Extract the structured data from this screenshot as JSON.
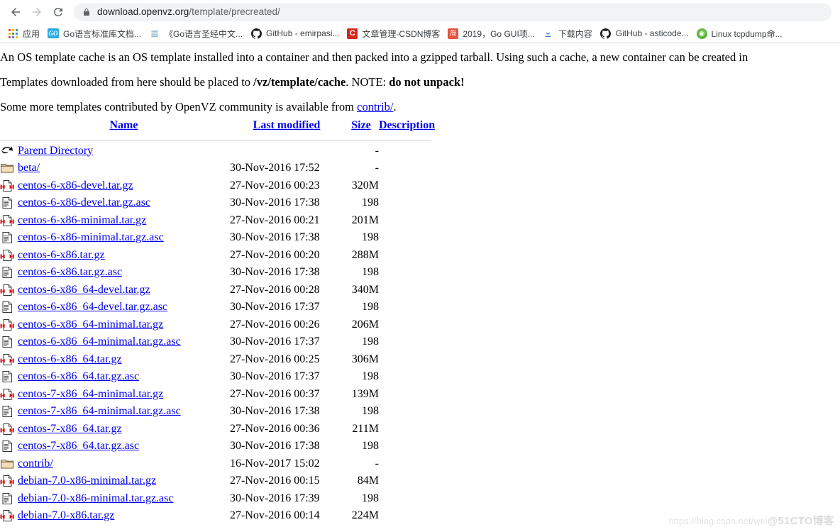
{
  "browser": {
    "back_icon": "back-arrow-icon",
    "forward_icon": "forward-arrow-icon",
    "reload_icon": "reload-icon",
    "lock_icon": "lock-icon",
    "url_host": "download.openvz.org",
    "url_path": "/template/precreated/",
    "url_full": "download.openvz.org/template/precreated/"
  },
  "bookmarks": [
    {
      "label": "应用",
      "icon": "apps-grid-icon"
    },
    {
      "label": "Go语言标准库文档...",
      "icon": "go-icon"
    },
    {
      "label": "《Go语言圣经中文...",
      "icon": "book-icon"
    },
    {
      "label": "GitHub - emirpasi...",
      "icon": "github-icon"
    },
    {
      "label": "文章管理-CSDN博客",
      "icon": "csdn-icon"
    },
    {
      "label": "2019，Go GUI项...",
      "icon": "jianshu-icon"
    },
    {
      "label": "下载内容",
      "icon": "download-icon"
    },
    {
      "label": "GitHub - asticode...",
      "icon": "github-icon"
    },
    {
      "label": "Linux tcpdump命...",
      "icon": "linux-icon"
    }
  ],
  "page": {
    "para1": "An OS template cache is an OS template installed into a container and then packed into a gzipped tarball. Using such a cache, a new container can be created in",
    "para2_pre": "Templates downloaded from here should be placed to ",
    "para2_path": "/vz/template/cache",
    "para2_mid": ". NOTE: ",
    "para2_bold": "do not unpack!",
    "para3_pre": "Some more templates contributed by OpenVZ community is available from ",
    "para3_link": "contrib/",
    "para3_post": "."
  },
  "table": {
    "headers": {
      "name": "Name",
      "last_modified": "Last modified",
      "size": "Size",
      "description": "Description"
    },
    "rows": [
      {
        "icon": "back-icon",
        "name": "Parent Directory",
        "modified": "",
        "size": "-",
        "desc": ""
      },
      {
        "icon": "folder-icon",
        "name": "beta/",
        "modified": "30-Nov-2016 17:52",
        "size": "-",
        "desc": ""
      },
      {
        "icon": "gz-icon",
        "name": "centos-6-x86-devel.tar.gz",
        "modified": "27-Nov-2016 00:23",
        "size": "320M",
        "desc": ""
      },
      {
        "icon": "text-icon",
        "name": "centos-6-x86-devel.tar.gz.asc",
        "modified": "30-Nov-2016 17:38",
        "size": "198",
        "desc": ""
      },
      {
        "icon": "gz-icon",
        "name": "centos-6-x86-minimal.tar.gz",
        "modified": "27-Nov-2016 00:21",
        "size": "201M",
        "desc": ""
      },
      {
        "icon": "text-icon",
        "name": "centos-6-x86-minimal.tar.gz.asc",
        "modified": "30-Nov-2016 17:38",
        "size": "198",
        "desc": ""
      },
      {
        "icon": "gz-icon",
        "name": "centos-6-x86.tar.gz",
        "modified": "27-Nov-2016 00:20",
        "size": "288M",
        "desc": ""
      },
      {
        "icon": "text-icon",
        "name": "centos-6-x86.tar.gz.asc",
        "modified": "30-Nov-2016 17:38",
        "size": "198",
        "desc": ""
      },
      {
        "icon": "gz-icon",
        "name": "centos-6-x86_64-devel.tar.gz",
        "modified": "27-Nov-2016 00:28",
        "size": "340M",
        "desc": ""
      },
      {
        "icon": "text-icon",
        "name": "centos-6-x86_64-devel.tar.gz.asc",
        "modified": "30-Nov-2016 17:37",
        "size": "198",
        "desc": ""
      },
      {
        "icon": "gz-icon",
        "name": "centos-6-x86_64-minimal.tar.gz",
        "modified": "27-Nov-2016 00:26",
        "size": "206M",
        "desc": ""
      },
      {
        "icon": "text-icon",
        "name": "centos-6-x86_64-minimal.tar.gz.asc",
        "modified": "30-Nov-2016 17:37",
        "size": "198",
        "desc": ""
      },
      {
        "icon": "gz-icon",
        "name": "centos-6-x86_64.tar.gz",
        "modified": "27-Nov-2016 00:25",
        "size": "306M",
        "desc": ""
      },
      {
        "icon": "text-icon",
        "name": "centos-6-x86_64.tar.gz.asc",
        "modified": "30-Nov-2016 17:37",
        "size": "198",
        "desc": ""
      },
      {
        "icon": "gz-icon",
        "name": "centos-7-x86_64-minimal.tar.gz",
        "modified": "27-Nov-2016 00:37",
        "size": "139M",
        "desc": ""
      },
      {
        "icon": "text-icon",
        "name": "centos-7-x86_64-minimal.tar.gz.asc",
        "modified": "30-Nov-2016 17:38",
        "size": "198",
        "desc": ""
      },
      {
        "icon": "gz-icon",
        "name": "centos-7-x86_64.tar.gz",
        "modified": "27-Nov-2016 00:36",
        "size": "211M",
        "desc": ""
      },
      {
        "icon": "text-icon",
        "name": "centos-7-x86_64.tar.gz.asc",
        "modified": "30-Nov-2016 17:38",
        "size": "198",
        "desc": ""
      },
      {
        "icon": "folder-icon",
        "name": "contrib/",
        "modified": "16-Nov-2017 15:02",
        "size": "-",
        "desc": ""
      },
      {
        "icon": "gz-icon",
        "name": "debian-7.0-x86-minimal.tar.gz",
        "modified": "27-Nov-2016 00:15",
        "size": "84M",
        "desc": ""
      },
      {
        "icon": "text-icon",
        "name": "debian-7.0-x86-minimal.tar.gz.asc",
        "modified": "30-Nov-2016 17:39",
        "size": "198",
        "desc": ""
      },
      {
        "icon": "gz-icon",
        "name": "debian-7.0-x86.tar.gz",
        "modified": "27-Nov-2016 00:14",
        "size": "224M",
        "desc": ""
      }
    ]
  },
  "watermark": {
    "url": "https://blog.csdn.net/wei",
    "brand": "@51CTO博客"
  },
  "colors": {
    "link": "#0000ee",
    "chrome_bg": "#ffffff",
    "omnibox_bg": "#f1f3f4",
    "text": "#202124",
    "muted": "#5f6368"
  }
}
